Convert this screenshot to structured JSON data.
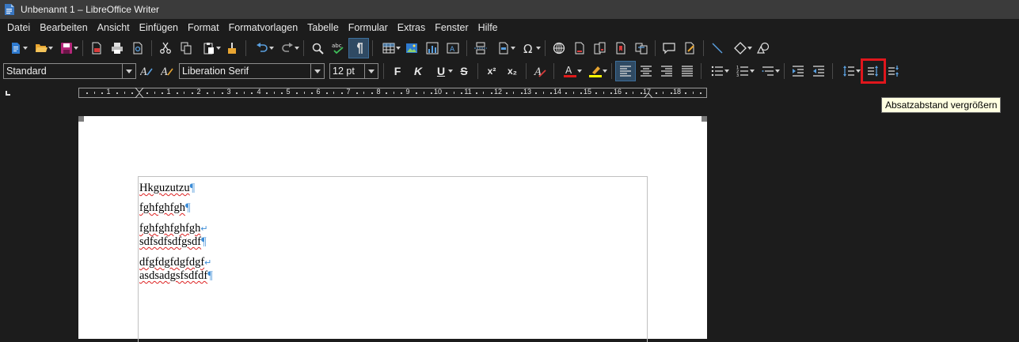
{
  "window": {
    "title": "Unbenannt 1 – LibreOffice Writer"
  },
  "menubar": {
    "items": [
      "Datei",
      "Bearbeiten",
      "Ansicht",
      "Einfügen",
      "Format",
      "Formatvorlagen",
      "Tabelle",
      "Formular",
      "Extras",
      "Fenster",
      "Hilfe"
    ]
  },
  "format_bar": {
    "paragraph_style": "Standard",
    "font_name": "Liberation Serif",
    "font_size": "12 pt",
    "bold_label": "F",
    "italic_label": "K",
    "underline_label": "U",
    "strike_label": "S",
    "superscript_label": "x²",
    "subscript_label": "x₂"
  },
  "ruler": {
    "numbers": [
      "1",
      "1",
      "2",
      "3",
      "4",
      "5",
      "6",
      "7",
      "8",
      "9",
      "10",
      "11",
      "12",
      "13",
      "14",
      "15",
      "16",
      "17",
      "18"
    ]
  },
  "document": {
    "paragraphs": [
      {
        "lines": [
          "Hkguzutzu"
        ],
        "end": "¶"
      },
      {
        "lines": [
          "fghfghfgh"
        ],
        "end": "¶"
      },
      {
        "lines": [
          "fghfghfghfgh",
          "sdfsdfsdfgsdf"
        ],
        "end": "¶"
      },
      {
        "lines": [
          "dfgfdgfdgfdgf",
          "asdsadgsfsdfdf"
        ],
        "end": "¶"
      }
    ],
    "pilcrow": "¶",
    "line_break": "↵"
  },
  "tooltip": {
    "text": "Absatzabstand vergrößern"
  },
  "colors": {
    "titlebar": "#3b3b3b",
    "background": "#1c1c1c",
    "accent_blue": "#3c8cd6",
    "highlight_box": "#e0161c",
    "font_color_bar": "#e01b1b",
    "highlight_color_bar": "#ffff00"
  }
}
